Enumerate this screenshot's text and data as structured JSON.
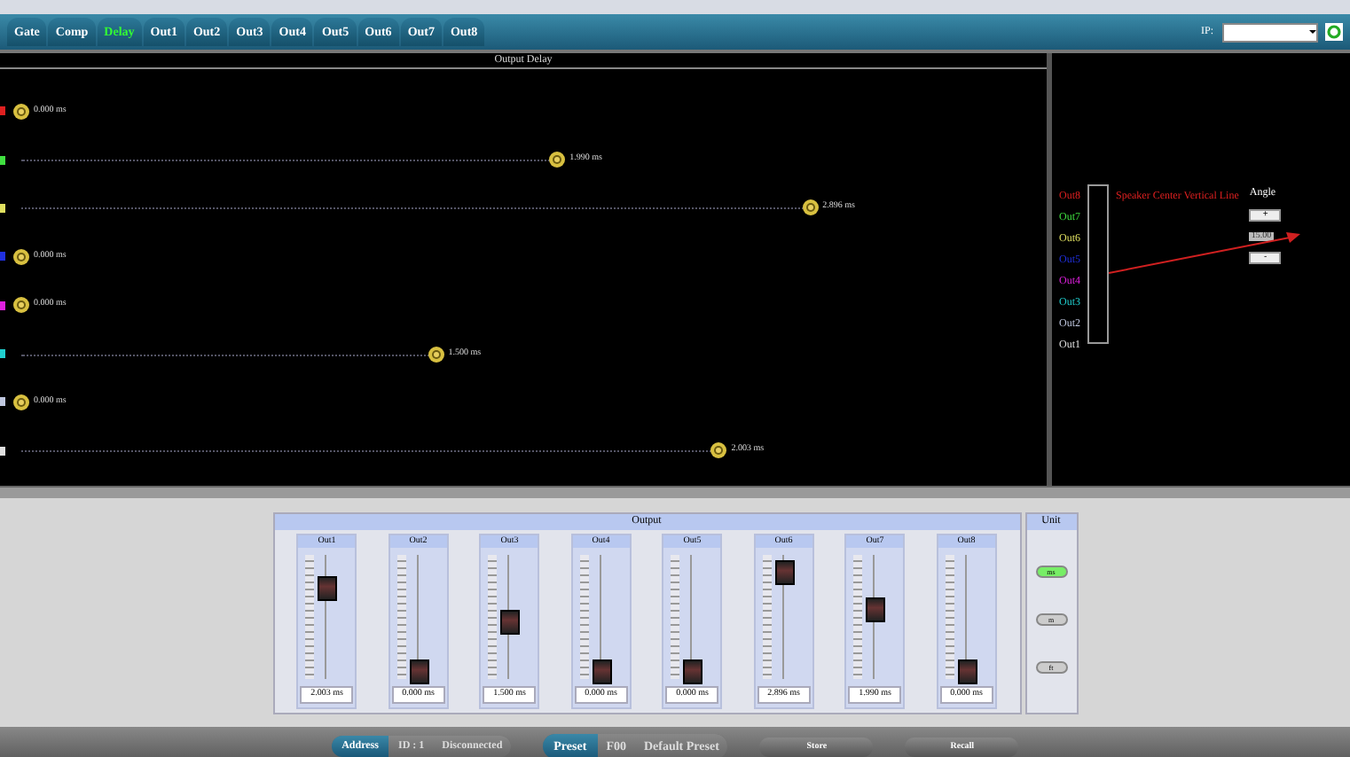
{
  "tabs": [
    {
      "label": "Gate",
      "selected": false
    },
    {
      "label": "Comp",
      "selected": false
    },
    {
      "label": "Delay",
      "selected": true
    },
    {
      "label": "Out1",
      "selected": false
    },
    {
      "label": "Out2",
      "selected": false
    },
    {
      "label": "Out3",
      "selected": false
    },
    {
      "label": "Out4",
      "selected": false
    },
    {
      "label": "Out5",
      "selected": false
    },
    {
      "label": "Out6",
      "selected": false
    },
    {
      "label": "Out7",
      "selected": false
    },
    {
      "label": "Out8",
      "selected": false
    }
  ],
  "ip": {
    "label": "IP:"
  },
  "delay_view": {
    "title": "Output Delay",
    "rows": [
      {
        "color": "#e02020",
        "level": 0,
        "reading": "0.000 ms"
      },
      {
        "color": "#40e040",
        "level": 0.53,
        "reading": "1.990 ms"
      },
      {
        "color": "#e0e060",
        "level": 0.78,
        "reading": "2.896 ms"
      },
      {
        "color": "#2030e0",
        "level": 0,
        "reading": "0.000 ms"
      },
      {
        "color": "#e020e0",
        "level": 0,
        "reading": "0.000 ms"
      },
      {
        "color": "#20d0d0",
        "level": 0.41,
        "reading": "1.500 ms"
      },
      {
        "color": "#c0c8e0",
        "level": 0,
        "reading": "0.000 ms"
      },
      {
        "color": "#e0e0e0",
        "level": 0.69,
        "reading": "2.003 ms"
      }
    ]
  },
  "speaker_view": {
    "legend": [
      {
        "label": "Out8",
        "color": "#e02020"
      },
      {
        "label": "Out7",
        "color": "#40e040"
      },
      {
        "label": "Out6",
        "color": "#e0e060"
      },
      {
        "label": "Out5",
        "color": "#2030e0"
      },
      {
        "label": "Out4",
        "color": "#e020e0"
      },
      {
        "label": "Out3",
        "color": "#20d0d0"
      },
      {
        "label": "Out2",
        "color": "#c0c8e0"
      },
      {
        "label": "Out1",
        "color": "#e0e0e0"
      }
    ],
    "annotation": "Speaker Center Vertical Line",
    "angle_label": "Angle",
    "plus": "+",
    "angle_value": "15.00",
    "minus": "-"
  },
  "output": {
    "title": "Output",
    "faders": [
      {
        "label": "Out1",
        "level": 0.72,
        "value": "2.003 ms"
      },
      {
        "label": "Out2",
        "level": 0.05,
        "value": "0.000 ms"
      },
      {
        "label": "Out3",
        "level": 0.45,
        "value": "1.500 ms"
      },
      {
        "label": "Out4",
        "level": 0.05,
        "value": "0.000 ms"
      },
      {
        "label": "Out5",
        "level": 0.05,
        "value": "0.000 ms"
      },
      {
        "label": "Out6",
        "level": 0.85,
        "value": "2.896 ms"
      },
      {
        "label": "Out7",
        "level": 0.55,
        "value": "1.990 ms"
      },
      {
        "label": "Out8",
        "level": 0.05,
        "value": "0.000 ms"
      }
    ]
  },
  "unit": {
    "title": "Unit",
    "options": [
      {
        "label": "ms",
        "selected": true
      },
      {
        "label": "m",
        "selected": false
      },
      {
        "label": "ft",
        "selected": false
      }
    ]
  },
  "footer": {
    "address": "Address",
    "id": "ID : 1",
    "status": "Disconnected",
    "preset": "Preset",
    "preset_number": "F00",
    "preset_name": "Default Preset",
    "store": "Store",
    "recall": "Recall"
  }
}
